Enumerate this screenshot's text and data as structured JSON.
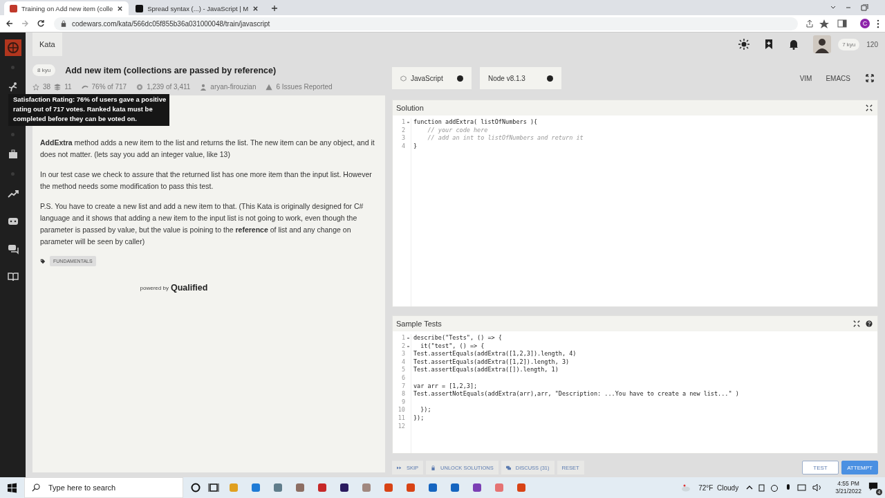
{
  "browser": {
    "tabs": [
      {
        "title": "Training on Add new item (colle",
        "selected": true
      },
      {
        "title": "Spread syntax (...) - JavaScript | M",
        "selected": false
      }
    ],
    "address": "codewars.com/kata/566dc05f855b36a031000048/train/javascript",
    "profile_initial": "C"
  },
  "header": {
    "tab": "Kata",
    "rank": "7 kyu",
    "honor": "120"
  },
  "kata": {
    "rank": "8 kyu",
    "title": "Add new item (collections are passed by reference)",
    "stats": {
      "stars": "38",
      "collections": "11",
      "rating": "76% of 717",
      "completed": "1,239 of 3,411",
      "author": "aryan-firouzian",
      "issues": "6 Issues Reported"
    },
    "tooltip": "Satisfaction Rating: 76% of users gave a positive rating out of 717 votes. Ranked kata must be completed before they can be voted on.",
    "description": [
      "**AddExtra** method adds a new item to the list and returns the list. The new item can be any object, and it does not matter. (lets say you add an integer value, like 13)",
      "In our test case we check to assure that the returned list has one more item than the input list. However the method needs some modification to pass this test.",
      "P.S. You have to create a new list and add a new item to that. (This Kata is originally designed for C# language and it shows that adding a new item to the input list is not going to work, even though the parameter is passed by value, but the value is poining to the **reference** of list and any change on parameter will be seen by caller)"
    ],
    "tags": [
      "FUNDAMENTALS"
    ],
    "powered_by": "powered by",
    "powered_brand": "Qualified"
  },
  "editor": {
    "language": "JavaScript",
    "version": "Node v8.1.3",
    "modes": [
      "VIM",
      "EMACS"
    ],
    "solution": {
      "title": "Solution",
      "lines": [
        {
          "num": "1",
          "text": "function addExtra( listOfNumbers ){",
          "kind": "code",
          "fold": true
        },
        {
          "num": "2",
          "text": "    // your code here",
          "kind": "comment",
          "fold": false
        },
        {
          "num": "3",
          "text": "    // add an int to listOfNumbers and return it",
          "kind": "comment",
          "fold": false
        },
        {
          "num": "4",
          "text": "}",
          "kind": "code",
          "fold": false
        }
      ]
    },
    "tests": {
      "title": "Sample Tests",
      "lines": [
        {
          "num": "1",
          "text": "describe(\"Tests\", () => {",
          "kind": "code",
          "fold": true
        },
        {
          "num": "2",
          "text": "  it(\"test\", () => {",
          "kind": "code",
          "fold": true
        },
        {
          "num": "3",
          "text": "Test.assertEquals(addExtra([1,2,3]).length, 4)",
          "kind": "code",
          "fold": false
        },
        {
          "num": "4",
          "text": "Test.assertEquals(addExtra([1,2]).length, 3)",
          "kind": "code",
          "fold": false
        },
        {
          "num": "5",
          "text": "Test.assertEquals(addExtra([]).length, 1)",
          "kind": "code",
          "fold": false
        },
        {
          "num": "6",
          "fold": false
        },
        {
          "num": "7",
          "text": "var arr = [1,2,3];",
          "kind": "code",
          "fold": false
        },
        {
          "num": "8",
          "text": "Test.assertNotEquals(addExtra(arr),arr, \"Description: ...You have to create a new list...\" )",
          "kind": "code",
          "fold": false
        },
        {
          "num": "9",
          "fold": false
        },
        {
          "num": "10",
          "text": "  });",
          "kind": "code",
          "fold": false
        },
        {
          "num": "11",
          "text": "});",
          "kind": "code",
          "fold": false
        },
        {
          "num": "12",
          "fold": false
        }
      ]
    },
    "actions": [
      {
        "label": "SKIP"
      },
      {
        "label": "UNLOCK SOLUTIONS"
      },
      {
        "label": "DISCUSS (31)"
      },
      {
        "label": "RESET"
      }
    ],
    "run": [
      {
        "label": "TEST",
        "kind": "outline"
      },
      {
        "label": "ATTEMPT",
        "kind": "primary"
      }
    ]
  },
  "taskbar": {
    "search_placeholder": "Type here to search",
    "weather": "72°F  Cloudy",
    "time": "4:55 PM",
    "date": "3/21/2022",
    "notifications": "4"
  }
}
